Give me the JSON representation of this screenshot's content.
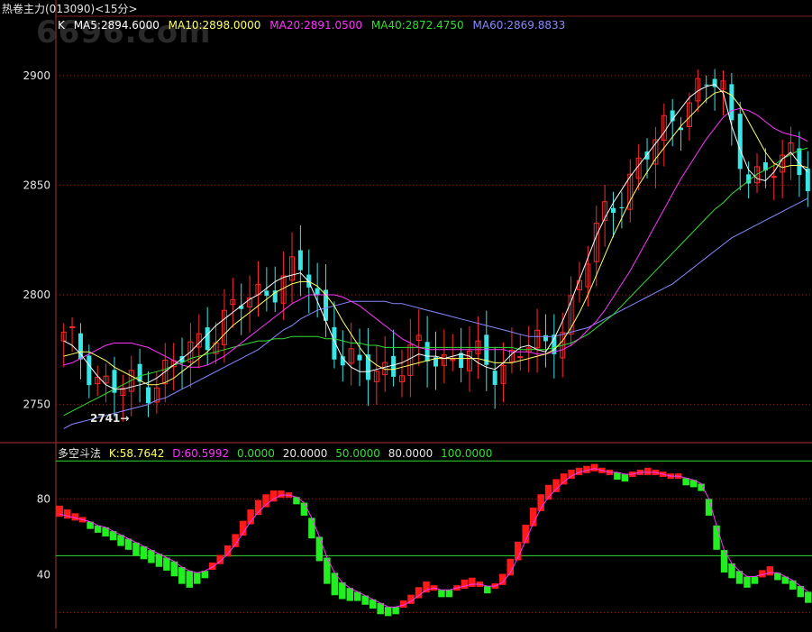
{
  "header": {
    "title": "热卷主力(013090)",
    "period": "<15分>",
    "watermark": "6696.com"
  },
  "colors": {
    "up": "#ff2a2a",
    "down": "#39e5e5",
    "ma5": "#ffffff",
    "ma10": "#ffff66",
    "ma20": "#ff33ff",
    "ma40": "#33dd33",
    "ma60": "#8888ff",
    "k_up": "#ff1a1a",
    "k_down": "#22ee22",
    "d": "#ff33ff"
  },
  "ma_legend": {
    "k_label": "K",
    "ma5": "MA5:2894.6000",
    "ma10": "MA10:2898.0000",
    "ma20": "MA20:2891.0500",
    "ma40": "MA40:2872.4750",
    "ma60": "MA60:2869.8833"
  },
  "indicator_legend": {
    "name": "多空斗法",
    "k": "K:58.7642",
    "d": "D:60.5992",
    "l0": "0.0000",
    "l20": "20.0000",
    "l50": "50.0000",
    "l80": "80.0000",
    "l100": "100.0000"
  },
  "low_annotation": "2741→",
  "chart_data": [
    {
      "type": "candlestick",
      "y_ticks": [
        "2900",
        "2850",
        "2800",
        "2750"
      ],
      "ylim": [
        2733,
        2918
      ],
      "lines": {
        "ma5": [
          2779,
          2777,
          2773,
          2768,
          2763,
          2759,
          2757,
          2757,
          2758,
          2759,
          2760,
          2762,
          2765,
          2768,
          2771,
          2774,
          2778,
          2782,
          2786,
          2789,
          2792,
          2795,
          2798,
          2800,
          2803,
          2806,
          2808,
          2809,
          2810,
          2806,
          2797,
          2788,
          2779,
          2771,
          2767,
          2765,
          2765,
          2766,
          2767,
          2768,
          2769,
          2771,
          2773,
          2772,
          2772,
          2771,
          2772,
          2773,
          2772,
          2769,
          2767,
          2766,
          2769,
          2773,
          2776,
          2777,
          2775,
          2774,
          2780,
          2788,
          2797,
          2807,
          2817,
          2827,
          2835,
          2842,
          2848,
          2854,
          2859,
          2864,
          2869,
          2874,
          2880,
          2885,
          2890,
          2893,
          2895,
          2896,
          2892,
          2877,
          2866,
          2857,
          2853,
          2852,
          2856,
          2862,
          2865,
          2860,
          2856
        ],
        "ma10": [
          2772,
          2773,
          2774,
          2774,
          2772,
          2770,
          2767,
          2765,
          2763,
          2761,
          2759,
          2759,
          2760,
          2762,
          2765,
          2768,
          2771,
          2774,
          2778,
          2782,
          2786,
          2789,
          2792,
          2795,
          2798,
          2801,
          2803,
          2805,
          2806,
          2806,
          2804,
          2800,
          2795,
          2788,
          2782,
          2776,
          2771,
          2768,
          2766,
          2766,
          2767,
          2768,
          2769,
          2770,
          2771,
          2771,
          2771,
          2771,
          2771,
          2771,
          2770,
          2769,
          2769,
          2769,
          2770,
          2771,
          2772,
          2773,
          2775,
          2779,
          2785,
          2792,
          2800,
          2809,
          2818,
          2827,
          2835,
          2843,
          2850,
          2856,
          2862,
          2867,
          2872,
          2877,
          2881,
          2885,
          2889,
          2892,
          2893,
          2891,
          2886,
          2879,
          2872,
          2865,
          2860,
          2858,
          2859,
          2859,
          2858
        ],
        "ma20": [
          2768,
          2769,
          2771,
          2773,
          2775,
          2777,
          2778,
          2778,
          2778,
          2777,
          2776,
          2774,
          2772,
          2770,
          2768,
          2767,
          2767,
          2768,
          2770,
          2772,
          2775,
          2778,
          2781,
          2784,
          2787,
          2790,
          2793,
          2796,
          2798,
          2800,
          2800,
          2800,
          2800,
          2799,
          2797,
          2795,
          2792,
          2789,
          2786,
          2783,
          2780,
          2778,
          2776,
          2775,
          2775,
          2775,
          2775,
          2775,
          2775,
          2775,
          2775,
          2775,
          2775,
          2774,
          2774,
          2774,
          2773,
          2773,
          2774,
          2775,
          2777,
          2780,
          2784,
          2788,
          2793,
          2799,
          2805,
          2811,
          2818,
          2825,
          2832,
          2839,
          2846,
          2853,
          2859,
          2865,
          2871,
          2876,
          2881,
          2884,
          2885,
          2884,
          2882,
          2879,
          2876,
          2874,
          2873,
          2872,
          2870
        ],
        "ma40": [
          2745,
          2747,
          2749,
          2751,
          2753,
          2755,
          2757,
          2759,
          2761,
          2763,
          2764,
          2765,
          2766,
          2768,
          2769,
          2771,
          2772,
          2773,
          2774,
          2775,
          2776,
          2777,
          2778,
          2779,
          2779,
          2780,
          2780,
          2781,
          2781,
          2781,
          2781,
          2780,
          2780,
          2779,
          2778,
          2778,
          2777,
          2777,
          2776,
          2776,
          2776,
          2776,
          2776,
          2776,
          2776,
          2776,
          2776,
          2776,
          2776,
          2776,
          2776,
          2776,
          2776,
          2776,
          2775,
          2775,
          2775,
          2775,
          2776,
          2777,
          2778,
          2780,
          2782,
          2785,
          2788,
          2791,
          2795,
          2799,
          2803,
          2807,
          2811,
          2815,
          2819,
          2823,
          2827,
          2831,
          2835,
          2839,
          2842,
          2846,
          2849,
          2852,
          2855,
          2857,
          2859,
          2862,
          2864,
          2866,
          2867
        ],
        "ma60": [
          2739,
          2741,
          2742,
          2743,
          2744,
          2745,
          2746,
          2747,
          2748,
          2749,
          2750,
          2752,
          2753,
          2755,
          2757,
          2759,
          2761,
          2763,
          2765,
          2767,
          2769,
          2771,
          2773,
          2775,
          2778,
          2781,
          2784,
          2786,
          2789,
          2791,
          2793,
          2794,
          2795,
          2796,
          2797,
          2797,
          2797,
          2797,
          2797,
          2796,
          2796,
          2795,
          2794,
          2793,
          2792,
          2791,
          2790,
          2789,
          2788,
          2787,
          2786,
          2785,
          2784,
          2783,
          2782,
          2781,
          2781,
          2781,
          2781,
          2782,
          2783,
          2784,
          2785,
          2787,
          2789,
          2791,
          2793,
          2795,
          2797,
          2799,
          2801,
          2803,
          2805,
          2808,
          2811,
          2814,
          2817,
          2820,
          2823,
          2826,
          2828,
          2830,
          2832,
          2834,
          2836,
          2838,
          2840,
          2842,
          2844
        ]
      }
    },
    {
      "type": "bar",
      "y_ticks": [
        "80",
        "40"
      ],
      "ylim": [
        15,
        103
      ],
      "reference_lines": [
        100,
        80,
        50,
        20
      ],
      "k": [
        75,
        73,
        71,
        69,
        67,
        65,
        63,
        61,
        58,
        56,
        53,
        51,
        49,
        47,
        45,
        42,
        38,
        36,
        38,
        41,
        45,
        49,
        54,
        60,
        67,
        73,
        78,
        81,
        83,
        83,
        82,
        80,
        74,
        62,
        50,
        38,
        32,
        30,
        29,
        29,
        27,
        25,
        22,
        21,
        22,
        25,
        28,
        32,
        35,
        33,
        31,
        31,
        33,
        36,
        37,
        35,
        33,
        34,
        39,
        47,
        56,
        65,
        74,
        81,
        86,
        89,
        92,
        94,
        95,
        96,
        97,
        95,
        94,
        93,
        92,
        93,
        94,
        95,
        94,
        93,
        92,
        92,
        90,
        89,
        87,
        74,
        56,
        44,
        41,
        38,
        36,
        38,
        41,
        43,
        40,
        38,
        35,
        31,
        28
      ],
      "d": [
        72,
        71,
        70,
        69,
        68,
        66,
        65,
        63,
        61,
        59,
        57,
        55,
        53,
        51,
        49,
        47,
        44,
        42,
        41,
        42,
        44,
        47,
        51,
        56,
        62,
        68,
        73,
        77,
        80,
        82,
        82,
        81,
        78,
        70,
        60,
        49,
        41,
        36,
        33,
        31,
        29,
        27,
        25,
        23,
        23,
        24,
        26,
        29,
        32,
        33,
        32,
        32,
        33,
        34,
        35,
        35,
        34,
        34,
        36,
        41,
        49,
        58,
        67,
        75,
        81,
        85,
        89,
        92,
        94,
        95,
        96,
        95,
        94,
        94,
        93,
        93,
        94,
        94,
        94,
        93,
        92,
        92,
        91,
        90,
        88,
        80,
        66,
        53,
        46,
        42,
        39,
        39,
        40,
        41,
        41,
        39,
        37,
        34,
        31
      ]
    }
  ]
}
